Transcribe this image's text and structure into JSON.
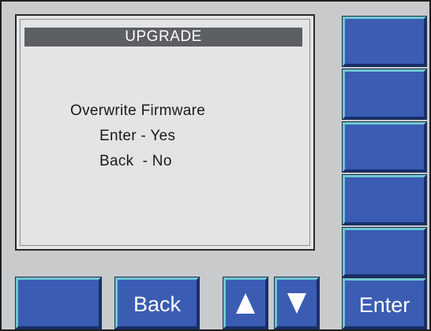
{
  "screen": {
    "title": "UPGRADE",
    "message_lines": [
      "Overwrite Firmware",
      "Enter - Yes",
      "Back  - No"
    ]
  },
  "buttons": {
    "back_label": "Back",
    "enter_label": "Enter",
    "up_icon": "up-arrow-icon",
    "down_icon": "down-arrow-icon"
  },
  "colors": {
    "panel": "#c8cacb",
    "screen": "#e2e4e6",
    "title_bar": "#5d6062",
    "button": "#3a5db3",
    "button_highlight": "#6fc7cf"
  }
}
